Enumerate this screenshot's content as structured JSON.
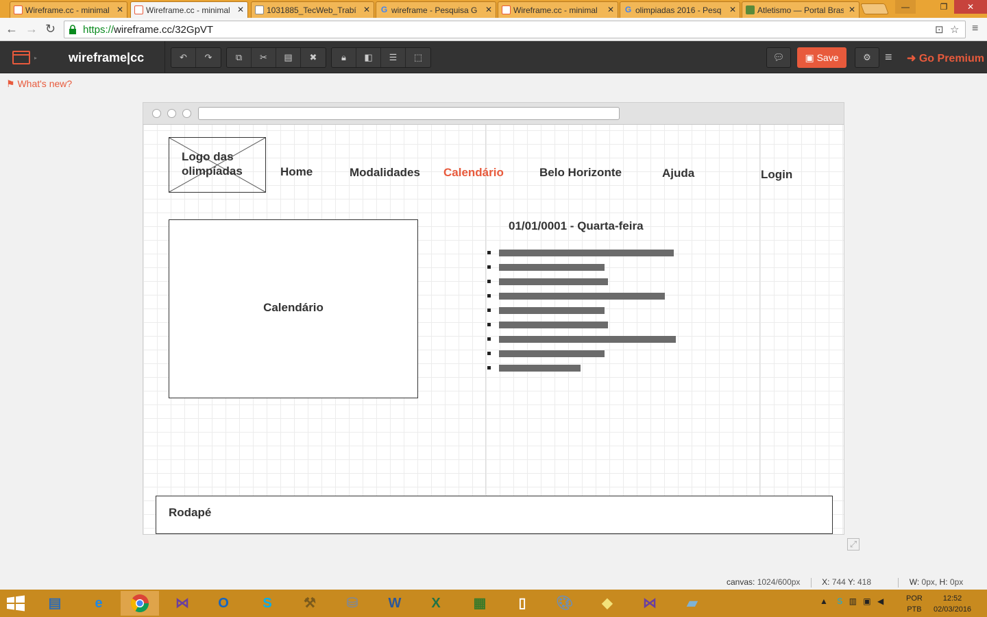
{
  "browser": {
    "tabs": [
      {
        "title": "Wireframe.cc - minimal",
        "icon": "wireframe-favicon"
      },
      {
        "title": "Wireframe.cc - minimal",
        "icon": "wireframe-favicon",
        "active": true
      },
      {
        "title": "1031885_TecWeb_Trabí",
        "icon": "document-favicon"
      },
      {
        "title": "wireframe - Pesquisa G",
        "icon": "google-favicon"
      },
      {
        "title": "Wireframe.cc - minimal",
        "icon": "wireframe-favicon"
      },
      {
        "title": "olimpiadas 2016 - Pesq",
        "icon": "google-favicon"
      },
      {
        "title": "Atletismo — Portal Bras",
        "icon": "cbat-favicon"
      }
    ],
    "url_scheme": "https://",
    "url_rest": "wireframe.cc/32GpVT"
  },
  "app": {
    "brand": "wireframe|cc",
    "save_label": "Save",
    "premium_label": "Go Premium",
    "whats_new": "What's new?",
    "accent": "#e85a3c"
  },
  "wireframe": {
    "logo_text": "Logo das olimpíadas",
    "nav": [
      "Home",
      "Modalidades",
      "Calendário",
      "Belo Horizonte",
      "Ajuda",
      "Login"
    ],
    "active_nav": "Calendário",
    "calendar_label": "Calendário",
    "date_heading": "01/01/0001 - Quarta-feira",
    "event_lines": 9,
    "footer_label": "Rodapé"
  },
  "status": {
    "canvas_label": "canvas:",
    "canvas_value": "1024/600px",
    "x_label": "X:",
    "x_value": "744",
    "y_label": "Y:",
    "y_value": "418",
    "w_label": "W:",
    "w_value": "0px,",
    "h_label": "H:",
    "h_value": "0px"
  },
  "system": {
    "lang_top": "POR",
    "lang_bottom": "PTB",
    "time": "12:52",
    "date": "02/03/2016"
  }
}
